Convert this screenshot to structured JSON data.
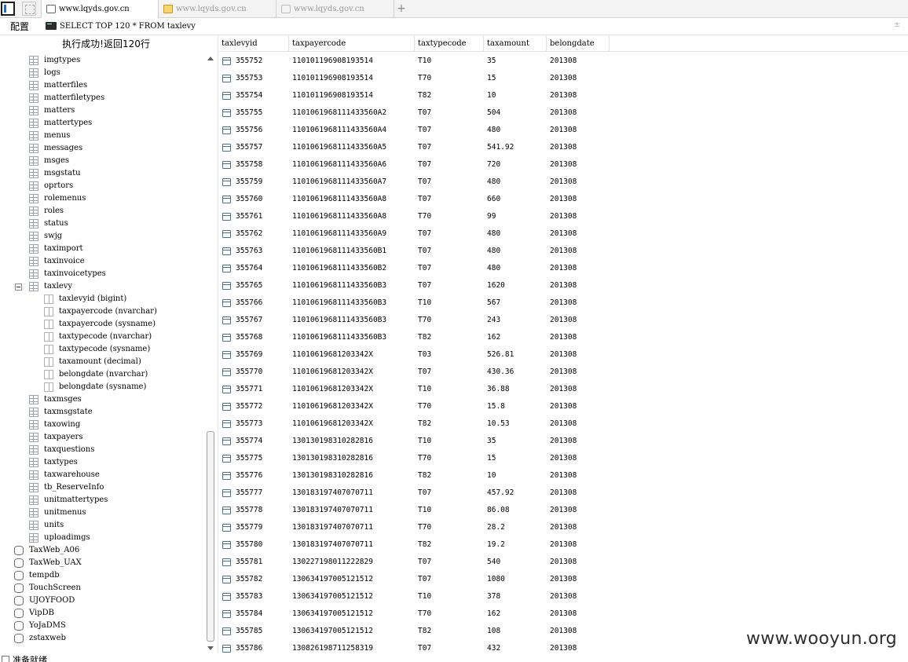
{
  "tabs": [
    {
      "title": "www.lqyds.gov.cn",
      "icon": "page-icon",
      "active": true
    },
    {
      "title": "www.lqyds.gov.cn",
      "icon": "folder-icon",
      "active": false
    },
    {
      "title": "www.lqyds.gov.cn",
      "icon": "page-icon",
      "active": false
    }
  ],
  "tab_add_label": "+",
  "toolbar": {
    "config_label": "配置",
    "query": "SELECT TOP 120 * FROM taxlevy",
    "expand_label": "±"
  },
  "status_message": "执行成功!返回120行",
  "tree": {
    "tables_before": [
      "imgtypes",
      "logs",
      "matterfiles",
      "matterfiletypes",
      "matters",
      "mattertypes",
      "menus",
      "messages",
      "msges",
      "msgstatu",
      "oprtors",
      "rolemenus",
      "roles",
      "status",
      "swjg",
      "taximport",
      "taxinvoice",
      "taxinvoicetypes"
    ],
    "expanded_table": "taxlevy",
    "expanded_collapse_symbol": "−",
    "columns": [
      "taxlevyid (bigint)",
      "taxpayercode (nvarchar)",
      "taxpayercode (sysname)",
      "taxtypecode (nvarchar)",
      "taxtypecode (sysname)",
      "taxamount (decimal)",
      "belongdate (nvarchar)",
      "belongdate (sysname)"
    ],
    "tables_after": [
      "taxmsges",
      "taxmsgstate",
      "taxowing",
      "taxpayers",
      "taxquestions",
      "taxtypes",
      "taxwarehouse",
      "tb_ReserveInfo",
      "unitmattertypes",
      "unitmenus",
      "units",
      "uploadimgs"
    ],
    "databases": [
      "TaxWeb_A06",
      "TaxWeb_UAX",
      "tempdb",
      "TouchScreen",
      "UJOYFOOD",
      "VipDB",
      "YoJaDMS",
      "zstaxweb"
    ]
  },
  "grid": {
    "columns": [
      "taxlevyid",
      "taxpayercode",
      "taxtypecode",
      "taxamount",
      "belongdate"
    ],
    "rows": [
      [
        "355752",
        "110101196908193514",
        "T10",
        "35",
        "201308"
      ],
      [
        "355753",
        "110101196908193514",
        "T70",
        "15",
        "201308"
      ],
      [
        "355754",
        "110101196908193514",
        "T82",
        "10",
        "201308"
      ],
      [
        "355755",
        "1101061968111433560A2",
        "T07",
        "504",
        "201308"
      ],
      [
        "355756",
        "1101061968111433560A4",
        "T07",
        "480",
        "201308"
      ],
      [
        "355757",
        "1101061968111433560A5",
        "T07",
        "541.92",
        "201308"
      ],
      [
        "355758",
        "1101061968111433560A6",
        "T07",
        "720",
        "201308"
      ],
      [
        "355759",
        "1101061968111433560A7",
        "T07",
        "480",
        "201308"
      ],
      [
        "355760",
        "1101061968111433560A8",
        "T07",
        "660",
        "201308"
      ],
      [
        "355761",
        "1101061968111433560A8",
        "T70",
        "99",
        "201308"
      ],
      [
        "355762",
        "1101061968111433560A9",
        "T07",
        "480",
        "201308"
      ],
      [
        "355763",
        "1101061968111433560B1",
        "T07",
        "480",
        "201308"
      ],
      [
        "355764",
        "1101061968111433560B2",
        "T07",
        "480",
        "201308"
      ],
      [
        "355765",
        "1101061968111433560B3",
        "T07",
        "1620",
        "201308"
      ],
      [
        "355766",
        "1101061968111433560B3",
        "T10",
        "567",
        "201308"
      ],
      [
        "355767",
        "1101061968111433560B3",
        "T70",
        "243",
        "201308"
      ],
      [
        "355768",
        "1101061968111433560B3",
        "T82",
        "162",
        "201308"
      ],
      [
        "355769",
        "11010619681203342X",
        "T03",
        "526.81",
        "201308"
      ],
      [
        "355770",
        "11010619681203342X",
        "T07",
        "430.36",
        "201308"
      ],
      [
        "355771",
        "11010619681203342X",
        "T10",
        "36.88",
        "201308"
      ],
      [
        "355772",
        "11010619681203342X",
        "T70",
        "15.8",
        "201308"
      ],
      [
        "355773",
        "11010619681203342X",
        "T82",
        "10.53",
        "201308"
      ],
      [
        "355774",
        "130130198310282816",
        "T10",
        "35",
        "201308"
      ],
      [
        "355775",
        "130130198310282816",
        "T70",
        "15",
        "201308"
      ],
      [
        "355776",
        "130130198310282816",
        "T82",
        "10",
        "201308"
      ],
      [
        "355777",
        "130183197407070711",
        "T07",
        "457.92",
        "201308"
      ],
      [
        "355778",
        "130183197407070711",
        "T10",
        "86.08",
        "201308"
      ],
      [
        "355779",
        "130183197407070711",
        "T70",
        "28.2",
        "201308"
      ],
      [
        "355780",
        "130183197407070711",
        "T82",
        "19.2",
        "201308"
      ],
      [
        "355781",
        "130227198011222829",
        "T07",
        "540",
        "201308"
      ],
      [
        "355782",
        "130634197005121512",
        "T07",
        "1080",
        "201308"
      ],
      [
        "355783",
        "130634197005121512",
        "T10",
        "378",
        "201308"
      ],
      [
        "355784",
        "130634197005121512",
        "T70",
        "162",
        "201308"
      ],
      [
        "355785",
        "130634197005121512",
        "T82",
        "108",
        "201308"
      ],
      [
        "355786",
        "130826198711258319",
        "T07",
        "432",
        "201308"
      ]
    ]
  },
  "footer_status": "准备就绪",
  "watermark": "www.wooyun.org"
}
